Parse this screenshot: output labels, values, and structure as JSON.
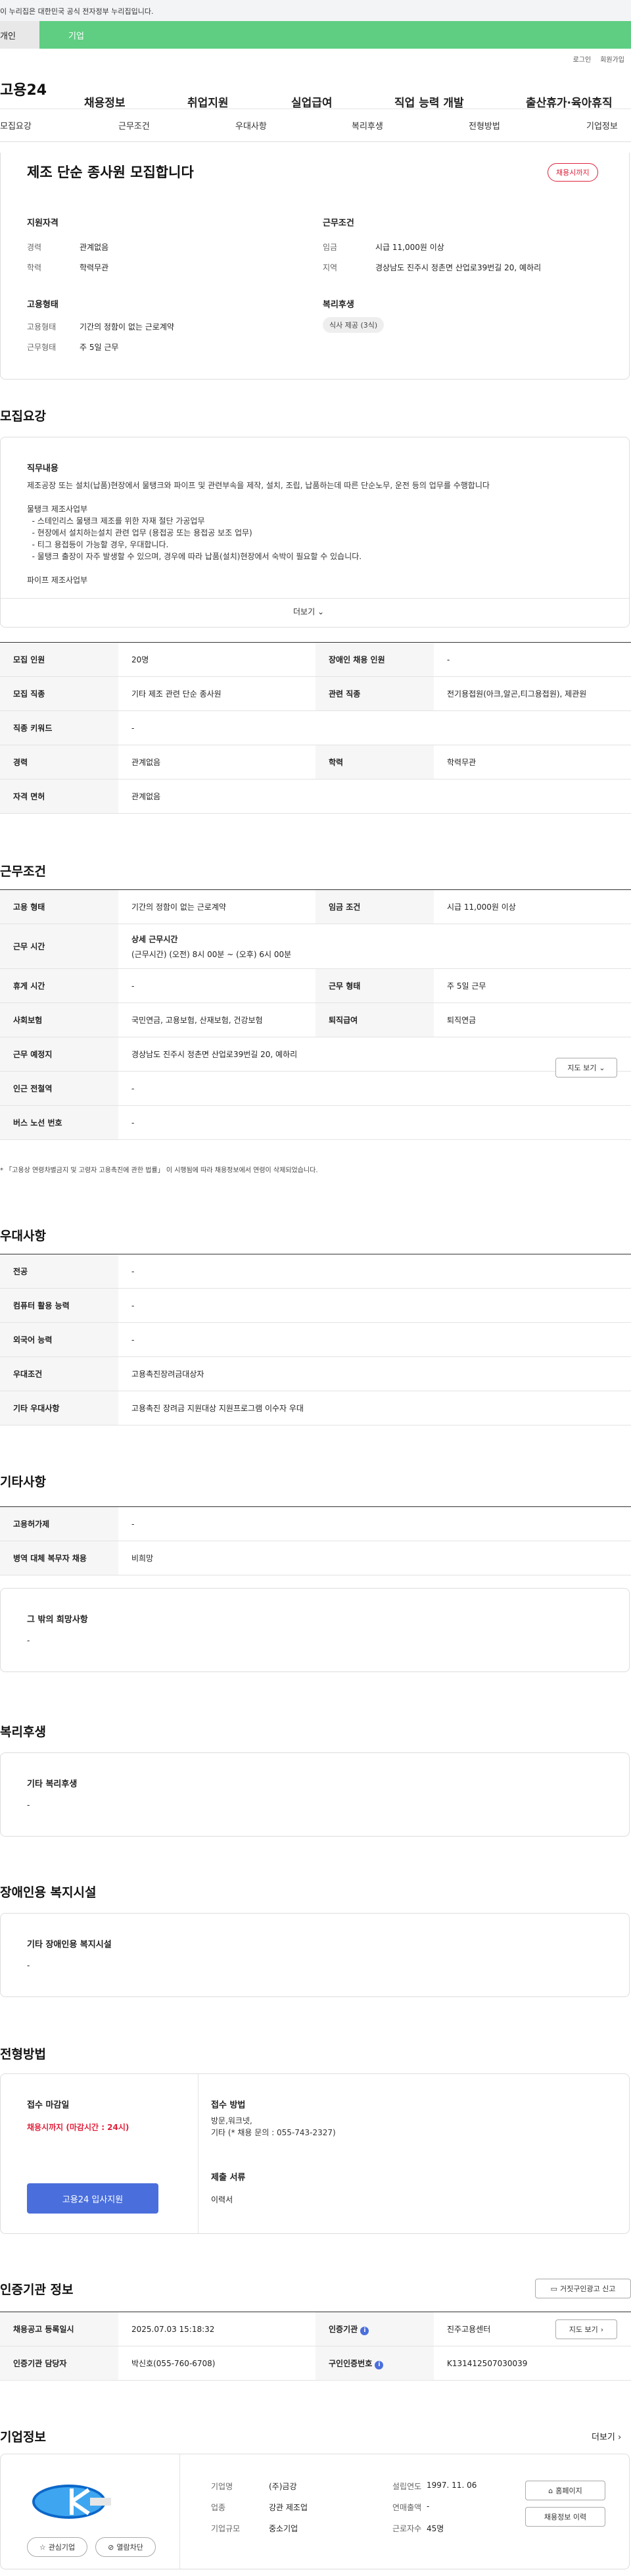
{
  "gov_banner": "이 누리집은 대한민국 공식 전자정부 누리집입니다.",
  "tabs": {
    "individual": "개인",
    "company": "기업"
  },
  "util": {
    "login": "로그인",
    "signup": "회원가입"
  },
  "gnb": {
    "logo": "고용24",
    "items": [
      "채용정보",
      "취업지원",
      "실업급여",
      "직업 능력 개발",
      "출산휴가·육아휴직"
    ]
  },
  "snb": [
    "모집요강",
    "근무조건",
    "우대사항",
    "복리후생",
    "전형방법",
    "기업정보"
  ],
  "summary": {
    "title": "제조 단순 종사원 모집합니다",
    "deadline_badge": "채용시까지",
    "qual_title": "지원자격",
    "career_label": "경력",
    "career": "관계없음",
    "edu_label": "학력",
    "edu": "학력무관",
    "cond_title": "근무조건",
    "wage_label": "임금",
    "wage": "시급 11,000원 이상",
    "region_label": "지역",
    "region": "경상남도 진주시 정촌면 산업로39번길 20, 예하리",
    "emp_title": "고용형태",
    "emp_type_label": "고용형태",
    "emp_type": "기간의 정함이 없는 근로계약",
    "work_type_label": "근무형태",
    "work_type": "주 5일 근무",
    "welfare_title": "복리후생",
    "welfare_pill": "식사 제공 (3식)"
  },
  "recruit": {
    "heading": "모집요강",
    "duty_title": "직무내용",
    "duty_text": "제조공장 또는 설치(납품)현장에서 물탱크와 파이프 및 관련부속을 제작, 설치, 조립, 납품하는데 따른 단순노무, 운전 등의 업무를 수행합니다\n\n물탱크 제조사업부\n  - 스테인리스 물탱크 제조를 위한 자재 절단 가공업무\n  - 현장에서 설치하는설치 관련 업무 (용접공 또는 용접공 보조 업무)\n  - 티그 용접등이 가능할 경우, 우대합니다.\n  - 물탱크 출장이 자주 발생할 수 있으며, 경우에 따라 납품(설치)현장에서 숙박이 필요할 수 있습니다.\n\n파이프 제조사업부",
    "more": "더보기",
    "rows": [
      {
        "l1": "모집 인원",
        "v1": "20명",
        "l2": "장애인 채용 인원",
        "v2": "-"
      },
      {
        "l1": "모집 직종",
        "v1": "기타 제조 관련 단순 종사원",
        "l2": "관련 직종",
        "v2": "전기용접원(아크,알곤,티그용접원), 제관원"
      },
      {
        "l1": "직종 키워드",
        "v1": "-"
      },
      {
        "l1": "경력",
        "v1": "관계없음",
        "l2": "학력",
        "v2": "학력무관"
      },
      {
        "l1": "자격 면허",
        "v1": "관계없음"
      }
    ]
  },
  "work": {
    "heading": "근무조건",
    "emp_type_l": "고용 형태",
    "emp_type": "기간의 정함이 없는 근로계약",
    "wage_l": "임금 조건",
    "wage": "시급 11,000원 이상",
    "hours_l": "근무 시간",
    "hours_title": "상세 근무시간",
    "hours": "(근무시간) (오전) 8시 00분 ~ (오후) 6시 00분",
    "rest_l": "휴게 시간",
    "rest": "-",
    "worktype_l": "근무 형태",
    "worktype": "주 5일 근무",
    "ins_l": "사회보험",
    "ins": "국민연금, 고용보험, 산재보험, 건강보험",
    "sev_l": "퇴직급여",
    "sev": "퇴직연금",
    "place_l": "근무 예정지",
    "place": "경상남도 진주시 정촌면 산업로39번길 20, 예하리",
    "map_btn": "지도 보기",
    "station_l": "인근 전철역",
    "station": "-",
    "bus_l": "버스 노선 번호",
    "bus": "-",
    "note": "* 「고용상 연령차별금지 및 고령자 고용촉진에 관한 법률」 이 시행됨에 따라 채용정보에서 연령이 삭제되었습니다."
  },
  "pref": {
    "heading": "우대사항",
    "rows": [
      {
        "l": "전공",
        "v": "-"
      },
      {
        "l": "컴퓨터 활용 능력",
        "v": "-"
      },
      {
        "l": "외국어 능력",
        "v": "-"
      },
      {
        "l": "우대조건",
        "v": "고용촉진장려금대상자"
      },
      {
        "l": "기타 우대사항",
        "v": "고용촉진 장려금 지원대상 지원프로그램 이수자 우대"
      }
    ]
  },
  "etc": {
    "heading": "기타사항",
    "rows": [
      {
        "l": "고용허가제",
        "v": "-"
      },
      {
        "l": "병역 대체 복무자 채용",
        "v": "비희망"
      }
    ],
    "other_title": "그 밖의 희망사항",
    "other": "-"
  },
  "welfare": {
    "heading": "복리후생",
    "title": "기타 복리후생",
    "value": "-"
  },
  "disabled": {
    "heading": "장애인용 복지시설",
    "title": "기타 장애인용 복지시설",
    "value": "-"
  },
  "process": {
    "heading": "전형방법",
    "deadline_title": "접수 마감일",
    "deadline": "채용시까지 (마감시간 : 24시)",
    "apply_btn": "고용24 입사지원",
    "method_title": "접수 방법",
    "method": "방문,워크넷,\n기타 (* 채용 문의 : 055-743-2327)",
    "docs_title": "제출 서류",
    "docs": "이력서"
  },
  "agency": {
    "heading": "인증기관 정보",
    "report_btn": "거짓구인광고 신고",
    "reg_l": "채용공고 등록일시",
    "reg": "2025.07.03 15:18:32",
    "org_l": "인증기관",
    "org": "진주고용센터",
    "map_btn": "지도 보기",
    "mgr_l": "인증기관 담당자",
    "mgr": "박신호(055-760-6708)",
    "num_l": "구인인증번호",
    "num": "K131412507030039"
  },
  "company": {
    "heading": "기업정보",
    "more": "더보기",
    "name_l": "기업명",
    "name": "(주)금강",
    "est_l": "설립연도",
    "est": "1997. 11. 06",
    "ind_l": "업종",
    "ind": "강관 제조업",
    "sales_l": "연매출액",
    "sales": "-",
    "size_l": "기업규모",
    "size": "중소기업",
    "emp_l": "근로자수",
    "emp": "45명",
    "homepage_btn": "홈페이지",
    "history_btn": "채용정보 이력",
    "fav_btn": "관심기업",
    "block_btn": "열람차단"
  }
}
